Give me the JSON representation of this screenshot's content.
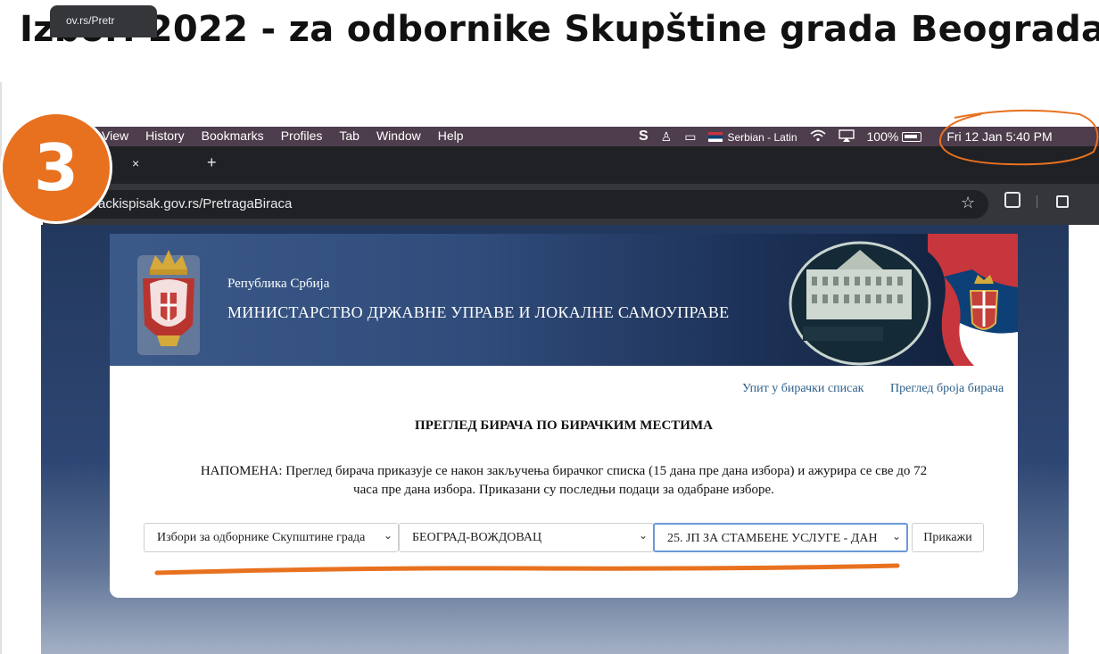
{
  "slide": {
    "title": "Izbori 2022 - za odbornike Skupštine grada Beograda",
    "step_number": "3"
  },
  "menubar": {
    "items": [
      "View",
      "History",
      "Bookmarks",
      "Profiles",
      "Tab",
      "Window",
      "Help"
    ],
    "language": "Serbian - Latin",
    "battery": "100%",
    "datetime": "Fri 12 Jan  5:40 PM"
  },
  "browser": {
    "tab_title": "ov.rs/Pretr",
    "tab_close": "×",
    "new_tab": "+",
    "url": "ackispisak.gov.rs/PretragaBiraca"
  },
  "site": {
    "republic": "Република Србија",
    "ministry": "МИНИСТАРСТВО ДРЖАВНЕ УПРАВЕ И ЛОКАЛНЕ САМОУПРАВЕ"
  },
  "links": {
    "query": "Упит у бирачки списак",
    "count": "Преглед броја бирача"
  },
  "content": {
    "heading": "ПРЕГЛЕД БИРАЧА ПО БИРАЧКИМ МЕСТИМА",
    "note": "НАПОМЕНА: Преглед бирача приказује се након закључења бирачког списка (15 дана пре дана избора) и ажурира се све до 72 часа пре дана избора. Приказани су последњи подаци за одабране изборе."
  },
  "form": {
    "election": "Избори за одборнике Скупштине града",
    "municipality": "БЕОГРАД-ВОЖДОВАЦ",
    "polling_station": "25. ЈП ЗА СТАМБЕНЕ УСЛУГЕ - ДАН",
    "show_button": "Прикажи"
  },
  "colors": {
    "accent_orange": "#e8711f",
    "menubar": "#4e3d4c",
    "link": "#2d5f8a"
  }
}
